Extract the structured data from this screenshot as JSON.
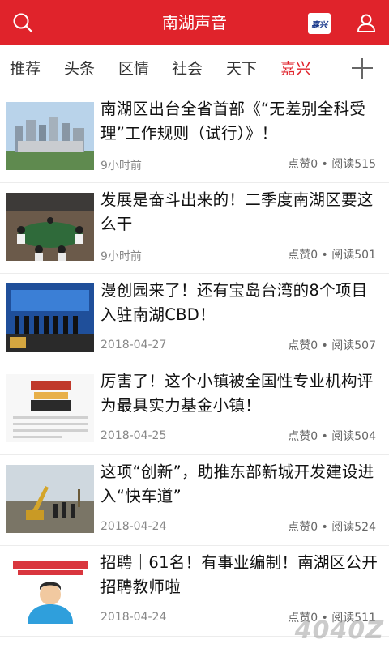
{
  "app": {
    "title": "南湖声音",
    "logo_text": "嘉兴"
  },
  "tabs": [
    {
      "label": "推荐",
      "active": false
    },
    {
      "label": "头条",
      "active": false
    },
    {
      "label": "区情",
      "active": false
    },
    {
      "label": "社会",
      "active": false
    },
    {
      "label": "天下",
      "active": false
    },
    {
      "label": "嘉兴",
      "active": true
    }
  ],
  "articles": [
    {
      "title": "南湖区出台全省首部《“无差别全科受理”工作规则（试行）》！",
      "time": "9小时前",
      "stats": "点赞0 • 阅读515",
      "thumb": "city-skyline"
    },
    {
      "title": "发展是奋斗出来的！二季度南湖区要这么干",
      "time": "9小时前",
      "stats": "点赞0 • 阅读501",
      "thumb": "meeting-room"
    },
    {
      "title": "漫创园来了！还有宝岛台湾的8个项目入驻南湖CBD！",
      "time": "2018-04-27",
      "stats": "点赞0 • 阅读507",
      "thumb": "stage-event"
    },
    {
      "title": "厉害了！这个小镇被全国性专业机构评为最具实力基金小镇！",
      "time": "2018-04-25",
      "stats": "点赞0 • 阅读504",
      "thumb": "top5-document"
    },
    {
      "title": "这项“创新”，助推东部新城开发建设进入“快车道”",
      "time": "2018-04-24",
      "stats": "点赞0 • 阅读524",
      "thumb": "construction-site"
    },
    {
      "title": "招聘｜61名！有事业编制！南湖区公开招聘教师啦",
      "time": "2018-04-24",
      "stats": "点赞0 • 阅读511",
      "thumb": "recruit-poster"
    }
  ],
  "watermark": "4040Z",
  "colors": {
    "brand": "#e0232b",
    "meta": "#888888"
  }
}
